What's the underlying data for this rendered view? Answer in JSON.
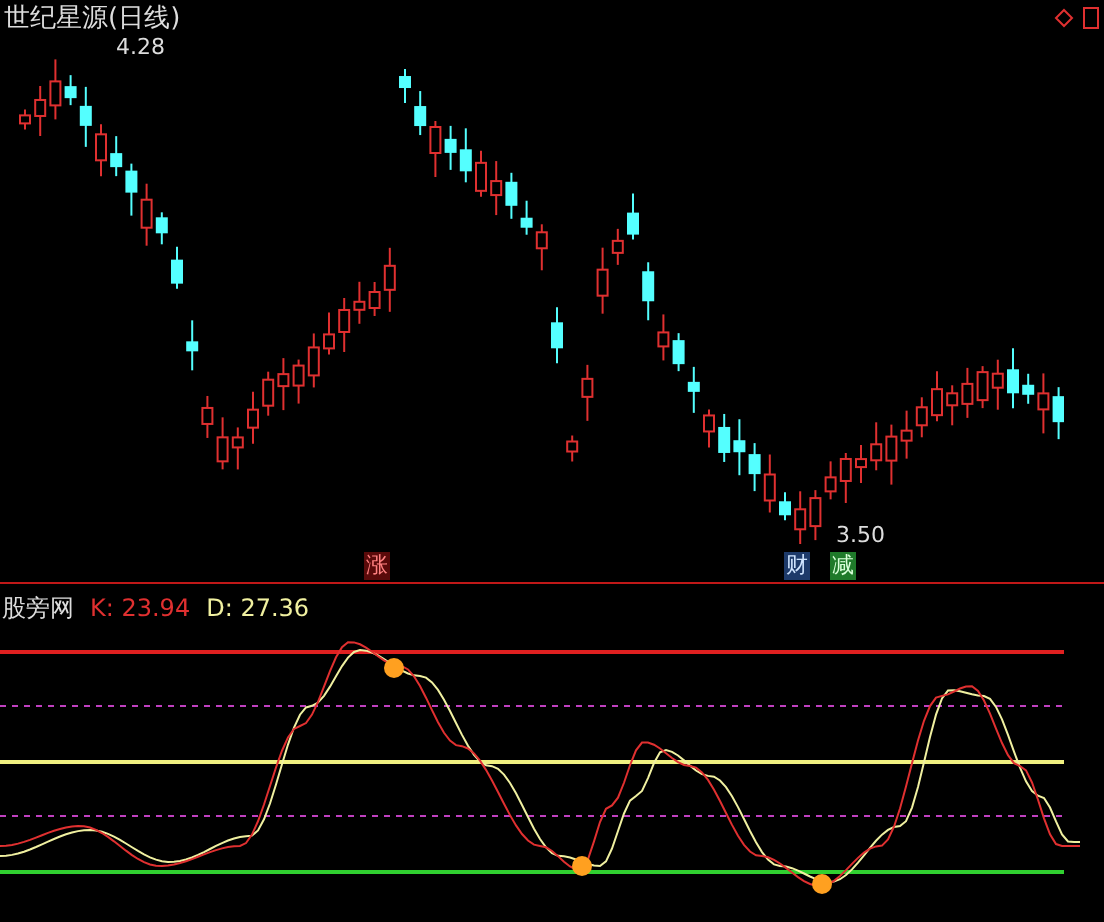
{
  "chart": {
    "title": "世纪星源(日线)",
    "high_label": "4.28",
    "low_label": "3.50",
    "signals": [
      {
        "text": "涨",
        "kind": "rise"
      },
      {
        "text": "财",
        "kind": "finance"
      },
      {
        "text": "减",
        "kind": "reduce"
      }
    ]
  },
  "indicator": {
    "name": "股旁网",
    "k": "K: 23.94",
    "d": "D: 27.36"
  }
}
